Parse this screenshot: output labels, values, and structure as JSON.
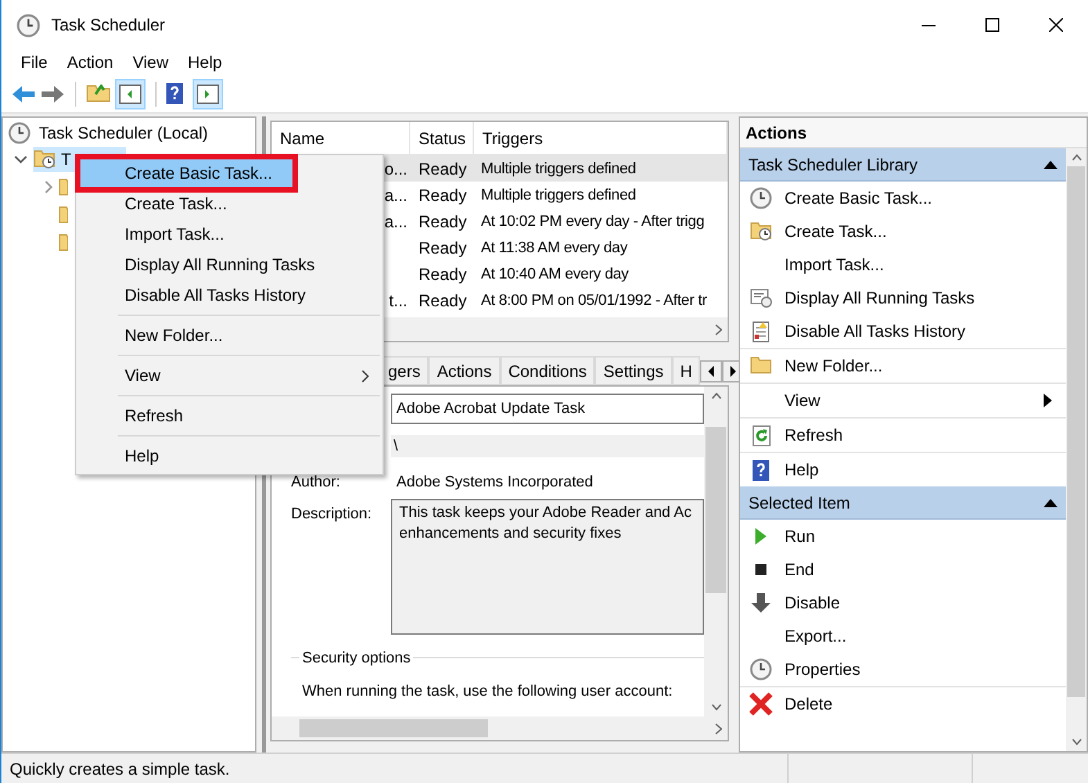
{
  "window": {
    "title": "Task Scheduler"
  },
  "menu_bar": [
    "File",
    "Action",
    "View",
    "Help"
  ],
  "tree": {
    "label": "Task Scheduler (Local)",
    "children": [
      {
        "label": "T",
        "expanded": true,
        "children": [
          {
            "kind": "expandable"
          },
          {
            "kind": "leaf"
          },
          {
            "kind": "leaf"
          }
        ]
      }
    ]
  },
  "context_menu": {
    "groups": [
      {
        "items": [
          {
            "label": "Create Basic Task...",
            "selected": true,
            "kind": "action"
          },
          {
            "label": "Create Task...",
            "selected": false,
            "kind": "action"
          },
          {
            "label": "Import Task...",
            "selected": false,
            "kind": "action"
          },
          {
            "label": "Display All Running Tasks",
            "selected": false,
            "kind": "action"
          },
          {
            "label": "Disable All Tasks History",
            "selected": false,
            "kind": "action"
          }
        ]
      },
      {
        "items": [
          {
            "label": "New Folder...",
            "selected": false,
            "kind": "action"
          }
        ]
      },
      {
        "items": [
          {
            "label": "View",
            "selected": false,
            "kind": "submenu"
          }
        ]
      },
      {
        "items": [
          {
            "label": "Refresh",
            "selected": false,
            "kind": "action"
          }
        ]
      },
      {
        "items": [
          {
            "label": "Help",
            "selected": false,
            "kind": "action"
          }
        ]
      }
    ]
  },
  "task_table": {
    "columns": [
      "Name",
      "Status",
      "Triggers"
    ],
    "rows": [
      {
        "name": "o...",
        "status": "Ready",
        "triggers": "Multiple triggers defined",
        "selected": true
      },
      {
        "name": "a...",
        "status": "Ready",
        "triggers": "Multiple triggers defined",
        "selected": false
      },
      {
        "name": "a...",
        "status": "Ready",
        "triggers": "At 10:02 PM every day - After trigg",
        "selected": false
      },
      {
        "name": "",
        "status": "Ready",
        "triggers": "At 11:38 AM every day",
        "selected": false
      },
      {
        "name": "",
        "status": "Ready",
        "triggers": "At 10:40 AM every day",
        "selected": false
      },
      {
        "name": "t...",
        "status": "Ready",
        "triggers": "At 8:00 PM on 05/01/1992 - After tr",
        "selected": false
      }
    ]
  },
  "detail_tabs": [
    {
      "label": "gers",
      "selected": false
    },
    {
      "label": "Actions",
      "selected": false
    },
    {
      "label": "Conditions",
      "selected": false
    },
    {
      "label": "Settings",
      "selected": false
    },
    {
      "label": "H",
      "selected": false
    }
  ],
  "details": {
    "name": "Adobe Acrobat Update Task",
    "location": "\\",
    "author_label": "Author:",
    "author": "Adobe Systems Incorporated",
    "description_label": "Description:",
    "description": "This task keeps your Adobe Reader and Ac\nenhancements and security fixes",
    "security_title": "Security options",
    "security_text": "When running the task, use the following user account:"
  },
  "actions_pane": {
    "title": "Actions",
    "sections": [
      {
        "title": "Task Scheduler Library",
        "expanded": true,
        "groups": [
          {
            "items": [
              {
                "label": "Create Basic Task...",
                "kind": "action"
              },
              {
                "label": "Create Task...",
                "kind": "action"
              },
              {
                "label": "Import Task...",
                "kind": "action"
              },
              {
                "label": "Display All Running Tasks",
                "kind": "action"
              },
              {
                "label": "Disable All Tasks History",
                "kind": "action"
              }
            ]
          },
          {
            "items": [
              {
                "label": "New Folder...",
                "kind": "action"
              }
            ]
          },
          {
            "items": [
              {
                "label": "View",
                "kind": "submenu"
              }
            ]
          },
          {
            "items": [
              {
                "label": "Refresh",
                "kind": "action"
              }
            ]
          },
          {
            "items": [
              {
                "label": "Help",
                "kind": "action"
              }
            ]
          }
        ]
      },
      {
        "title": "Selected Item",
        "expanded": true,
        "groups": [
          {
            "items": [
              {
                "label": "Run",
                "kind": "action"
              },
              {
                "label": "End",
                "kind": "action"
              },
              {
                "label": "Disable",
                "kind": "action"
              },
              {
                "label": "Export...",
                "kind": "action"
              },
              {
                "label": "Properties",
                "kind": "action"
              }
            ]
          },
          {
            "items": [
              {
                "label": "Delete",
                "kind": "action"
              }
            ]
          }
        ]
      }
    ]
  },
  "status_bar": "Quickly creates a simple task."
}
